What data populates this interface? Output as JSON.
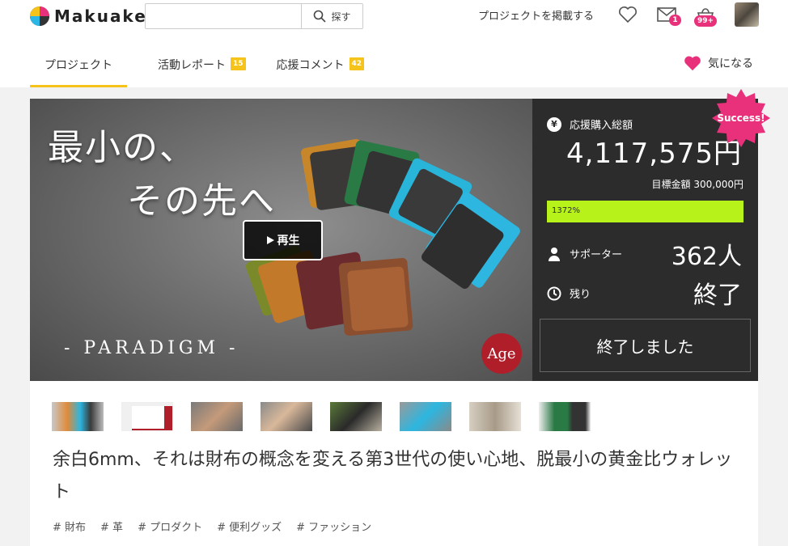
{
  "header": {
    "logo_text": "Makuake",
    "search": {
      "placeholder": "",
      "button_label": "探す"
    },
    "post_project_label": "プロジェクトを掲載する",
    "message_badge": "1",
    "cart_badge": "99+"
  },
  "tabs": [
    {
      "label": "プロジェクト",
      "count": ""
    },
    {
      "label": "活動レポート",
      "count": "15"
    },
    {
      "label": "応援コメント",
      "count": "42"
    }
  ],
  "watch_label": "気になる",
  "hero": {
    "title_line1": "最小の、",
    "title_line2": "その先へ",
    "brand": "- PARADIGM -",
    "play_label": "再生",
    "brand_logo": "Age"
  },
  "panel": {
    "total_label": "応援購入総額",
    "total_value": "4,117,575円",
    "goal_text": "目標金額 300,000円",
    "percent_text": "1372%",
    "progress_fraction": 1.0,
    "supporters_label": "サポーター",
    "supporters_value": "362人",
    "remaining_label": "残り",
    "remaining_value": "終了",
    "ended_button": "終了しました",
    "success_badge": "Success!"
  },
  "project": {
    "title": "余白6mm、それは財布の概念を変える第3世代の使い心地、脱最小の黄金比ウォレット",
    "tags": [
      "# 財布",
      "# 革",
      "# プロダクト",
      "# 便利グッズ",
      "# ファッション"
    ]
  },
  "colors": {
    "accent_yellow": "#f5c31a",
    "badge_pink": "#e8317a",
    "progress_green": "#b7f21a",
    "panel_dark": "#2c2c2c"
  }
}
